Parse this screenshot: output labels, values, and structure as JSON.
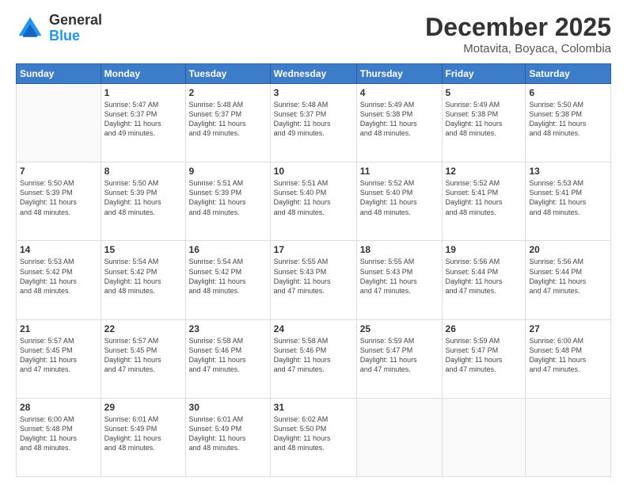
{
  "header": {
    "logo": {
      "general": "General",
      "blue": "Blue"
    },
    "title": "December 2025",
    "location": "Motavita, Boyaca, Colombia"
  },
  "weekdays": [
    "Sunday",
    "Monday",
    "Tuesday",
    "Wednesday",
    "Thursday",
    "Friday",
    "Saturday"
  ],
  "weeks": [
    [
      {
        "day": "",
        "info": ""
      },
      {
        "day": "1",
        "info": "Sunrise: 5:47 AM\nSunset: 5:37 PM\nDaylight: 11 hours\nand 49 minutes."
      },
      {
        "day": "2",
        "info": "Sunrise: 5:48 AM\nSunset: 5:37 PM\nDaylight: 11 hours\nand 49 minutes."
      },
      {
        "day": "3",
        "info": "Sunrise: 5:48 AM\nSunset: 5:37 PM\nDaylight: 11 hours\nand 49 minutes."
      },
      {
        "day": "4",
        "info": "Sunrise: 5:49 AM\nSunset: 5:38 PM\nDaylight: 11 hours\nand 48 minutes."
      },
      {
        "day": "5",
        "info": "Sunrise: 5:49 AM\nSunset: 5:38 PM\nDaylight: 11 hours\nand 48 minutes."
      },
      {
        "day": "6",
        "info": "Sunrise: 5:50 AM\nSunset: 5:38 PM\nDaylight: 11 hours\nand 48 minutes."
      }
    ],
    [
      {
        "day": "7",
        "info": "Sunrise: 5:50 AM\nSunset: 5:39 PM\nDaylight: 11 hours\nand 48 minutes."
      },
      {
        "day": "8",
        "info": "Sunrise: 5:50 AM\nSunset: 5:39 PM\nDaylight: 11 hours\nand 48 minutes."
      },
      {
        "day": "9",
        "info": "Sunrise: 5:51 AM\nSunset: 5:39 PM\nDaylight: 11 hours\nand 48 minutes."
      },
      {
        "day": "10",
        "info": "Sunrise: 5:51 AM\nSunset: 5:40 PM\nDaylight: 11 hours\nand 48 minutes."
      },
      {
        "day": "11",
        "info": "Sunrise: 5:52 AM\nSunset: 5:40 PM\nDaylight: 11 hours\nand 48 minutes."
      },
      {
        "day": "12",
        "info": "Sunrise: 5:52 AM\nSunset: 5:41 PM\nDaylight: 11 hours\nand 48 minutes."
      },
      {
        "day": "13",
        "info": "Sunrise: 5:53 AM\nSunset: 5:41 PM\nDaylight: 11 hours\nand 48 minutes."
      }
    ],
    [
      {
        "day": "14",
        "info": "Sunrise: 5:53 AM\nSunset: 5:42 PM\nDaylight: 11 hours\nand 48 minutes."
      },
      {
        "day": "15",
        "info": "Sunrise: 5:54 AM\nSunset: 5:42 PM\nDaylight: 11 hours\nand 48 minutes."
      },
      {
        "day": "16",
        "info": "Sunrise: 5:54 AM\nSunset: 5:42 PM\nDaylight: 11 hours\nand 48 minutes."
      },
      {
        "day": "17",
        "info": "Sunrise: 5:55 AM\nSunset: 5:43 PM\nDaylight: 11 hours\nand 47 minutes."
      },
      {
        "day": "18",
        "info": "Sunrise: 5:55 AM\nSunset: 5:43 PM\nDaylight: 11 hours\nand 47 minutes."
      },
      {
        "day": "19",
        "info": "Sunrise: 5:56 AM\nSunset: 5:44 PM\nDaylight: 11 hours\nand 47 minutes."
      },
      {
        "day": "20",
        "info": "Sunrise: 5:56 AM\nSunset: 5:44 PM\nDaylight: 11 hours\nand 47 minutes."
      }
    ],
    [
      {
        "day": "21",
        "info": "Sunrise: 5:57 AM\nSunset: 5:45 PM\nDaylight: 11 hours\nand 47 minutes."
      },
      {
        "day": "22",
        "info": "Sunrise: 5:57 AM\nSunset: 5:45 PM\nDaylight: 11 hours\nand 47 minutes."
      },
      {
        "day": "23",
        "info": "Sunrise: 5:58 AM\nSunset: 5:46 PM\nDaylight: 11 hours\nand 47 minutes."
      },
      {
        "day": "24",
        "info": "Sunrise: 5:58 AM\nSunset: 5:46 PM\nDaylight: 11 hours\nand 47 minutes."
      },
      {
        "day": "25",
        "info": "Sunrise: 5:59 AM\nSunset: 5:47 PM\nDaylight: 11 hours\nand 47 minutes."
      },
      {
        "day": "26",
        "info": "Sunrise: 5:59 AM\nSunset: 5:47 PM\nDaylight: 11 hours\nand 47 minutes."
      },
      {
        "day": "27",
        "info": "Sunrise: 6:00 AM\nSunset: 5:48 PM\nDaylight: 11 hours\nand 47 minutes."
      }
    ],
    [
      {
        "day": "28",
        "info": "Sunrise: 6:00 AM\nSunset: 5:48 PM\nDaylight: 11 hours\nand 48 minutes."
      },
      {
        "day": "29",
        "info": "Sunrise: 6:01 AM\nSunset: 5:49 PM\nDaylight: 11 hours\nand 48 minutes."
      },
      {
        "day": "30",
        "info": "Sunrise: 6:01 AM\nSunset: 5:49 PM\nDaylight: 11 hours\nand 48 minutes."
      },
      {
        "day": "31",
        "info": "Sunrise: 6:02 AM\nSunset: 5:50 PM\nDaylight: 11 hours\nand 48 minutes."
      },
      {
        "day": "",
        "info": ""
      },
      {
        "day": "",
        "info": ""
      },
      {
        "day": "",
        "info": ""
      }
    ]
  ]
}
